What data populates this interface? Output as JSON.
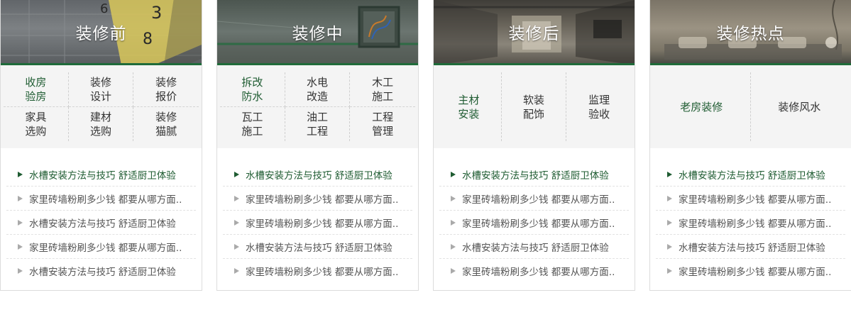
{
  "cards": [
    {
      "title": "装修前",
      "links": [
        {
          "label": "收房验房",
          "green": true
        },
        {
          "label": "装修设计"
        },
        {
          "label": "装修报价"
        },
        {
          "label": "家具选购"
        },
        {
          "label": "建材选购"
        },
        {
          "label": "装修猫腻"
        }
      ],
      "articles": [
        {
          "text": "水槽安装方法与技巧 舒适厨卫体验",
          "active": true
        },
        {
          "text": "家里砖墙粉刷多少钱 都要从哪方面.."
        },
        {
          "text": "水槽安装方法与技巧 舒适厨卫体验"
        },
        {
          "text": "家里砖墙粉刷多少钱 都要从哪方面.."
        },
        {
          "text": "水槽安装方法与技巧 舒适厨卫体验"
        }
      ]
    },
    {
      "title": "装修中",
      "links": [
        {
          "label": "拆改防水",
          "green": true
        },
        {
          "label": "水电改造"
        },
        {
          "label": "木工施工"
        },
        {
          "label": "瓦工施工"
        },
        {
          "label": "油工工程"
        },
        {
          "label": "工程管理"
        }
      ],
      "articles": [
        {
          "text": "水槽安装方法与技巧 舒适厨卫体验",
          "active": true
        },
        {
          "text": "家里砖墙粉刷多少钱 都要从哪方面.."
        },
        {
          "text": "家里砖墙粉刷多少钱 都要从哪方面.."
        },
        {
          "text": "水槽安装方法与技巧 舒适厨卫体验"
        },
        {
          "text": "家里砖墙粉刷多少钱 都要从哪方面.."
        }
      ]
    },
    {
      "title": "装修后",
      "links": [
        {
          "label": "主材安装",
          "green": true
        },
        {
          "label": "软装配饰"
        },
        {
          "label": "监理验收"
        }
      ],
      "articles": [
        {
          "text": "水槽安装方法与技巧 舒适厨卫体验",
          "active": true
        },
        {
          "text": "家里砖墙粉刷多少钱 都要从哪方面.."
        },
        {
          "text": "家里砖墙粉刷多少钱 都要从哪方面.."
        },
        {
          "text": "水槽安装方法与技巧 舒适厨卫体验"
        },
        {
          "text": "家里砖墙粉刷多少钱 都要从哪方面.."
        }
      ]
    },
    {
      "title": "装修热点",
      "links": [
        {
          "label": "老房装修",
          "green": true
        },
        {
          "label": "装修风水"
        }
      ],
      "articles": [
        {
          "text": "水槽安装方法与技巧 舒适厨卫体验",
          "active": true
        },
        {
          "text": "家里砖墙粉刷多少钱 都要从哪方面.."
        },
        {
          "text": "家里砖墙粉刷多少钱 都要从哪方面.."
        },
        {
          "text": "水槽安装方法与技巧 舒适厨卫体验"
        },
        {
          "text": "家里砖墙粉刷多少钱 都要从哪方面.."
        }
      ]
    }
  ],
  "colors": {
    "accent": "#1f6b3a",
    "active_text": "#1f5c32",
    "panel_bg": "#f4f4f4"
  }
}
